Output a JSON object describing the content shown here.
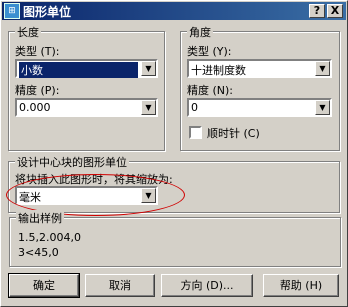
{
  "window": {
    "title": "图形单位",
    "icon_text": "cad",
    "help_button": "?",
    "close_button": "X"
  },
  "length": {
    "group_title": "长度",
    "type_label": "类型 (T):",
    "type_value": "小数",
    "precision_label": "精度 (P):",
    "precision_value": "0.000"
  },
  "angle": {
    "group_title": "角度",
    "type_label": "类型 (Y):",
    "type_value": "十进制度数",
    "precision_label": "精度 (N):",
    "precision_value": "0",
    "clockwise_label": "顺时针 (C)",
    "clockwise_checked": false
  },
  "insertion": {
    "group_title": "设计中心块的图形单位",
    "prompt": "将块插入此图形时，将其缩放为:",
    "unit_value": "毫米",
    "highlight_color": "#d00000"
  },
  "sample": {
    "group_title": "输出样例",
    "line1": "1.5,2.004,0",
    "line2": "3<45,0"
  },
  "buttons": {
    "ok": "确定",
    "cancel": "取消",
    "direction": "方向 (D)...",
    "help": "帮助 (H)"
  },
  "colors": {
    "title_bar": "#0a246a",
    "face": "#d4d0c8",
    "selection": "#0a246a"
  }
}
